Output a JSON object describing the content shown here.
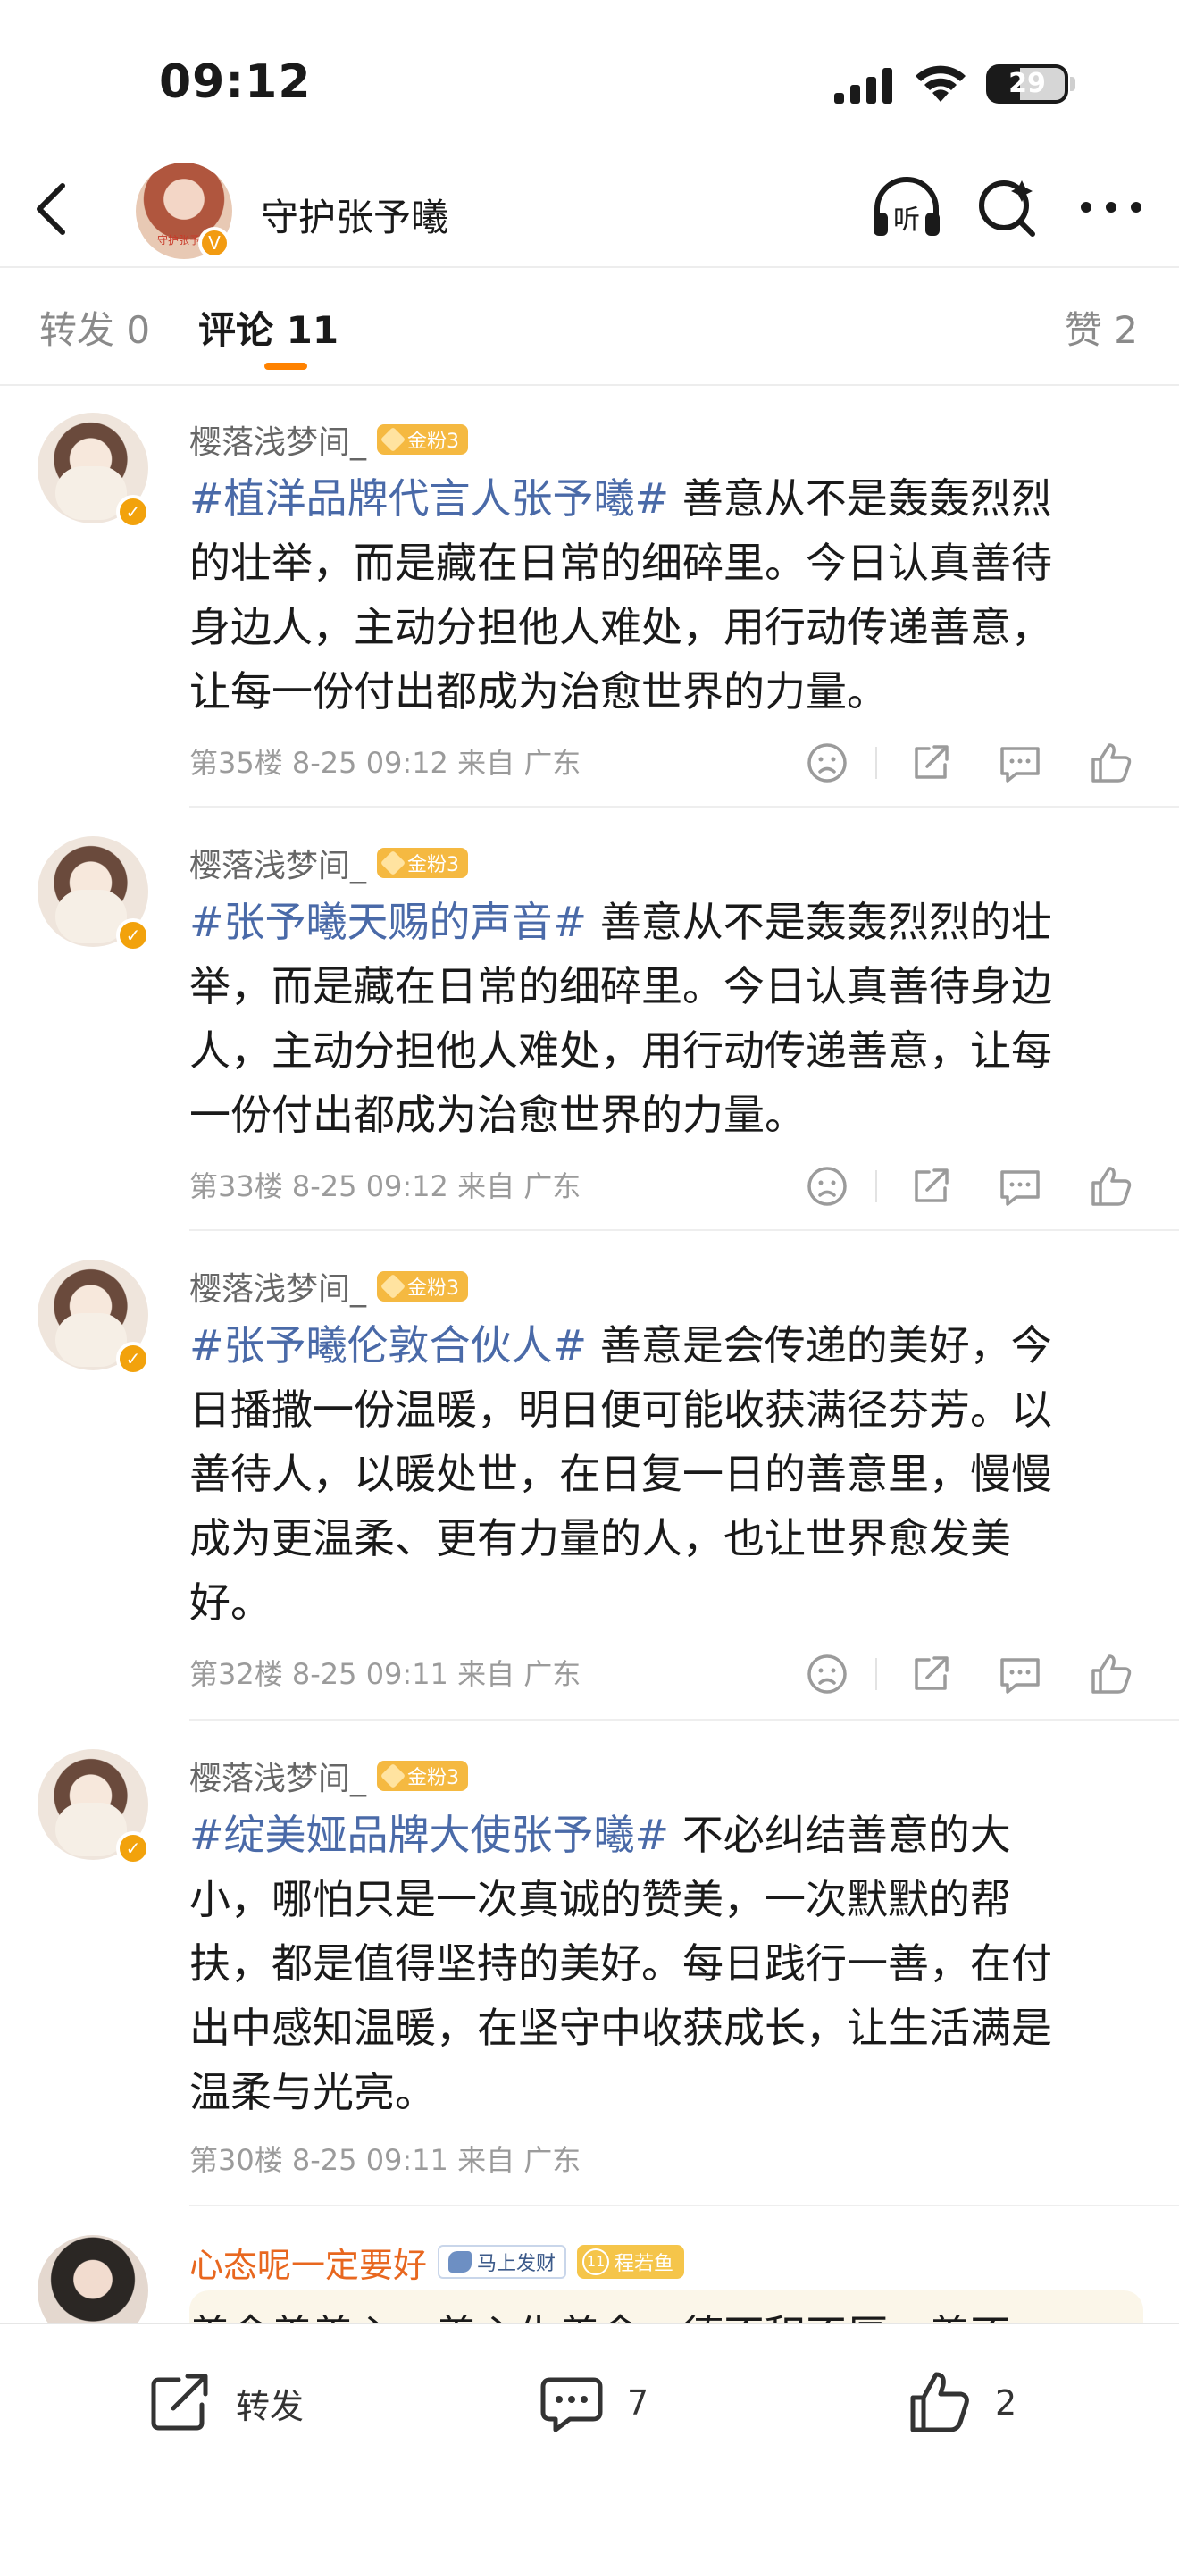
{
  "status_bar": {
    "time": "09:12",
    "battery": "29"
  },
  "nav": {
    "title": "守护张予曦",
    "avatar_caption": "守护张予曦"
  },
  "tabs": {
    "repost": "转发 0",
    "comments": "评论 11",
    "likes": "赞 2"
  },
  "comments": [
    {
      "user": "樱落浅梦间_",
      "badge": "金粉3",
      "topic": "#植洋品牌代言人张予曦#",
      "line1": " 善意从不是轰轰烈烈",
      "line2": "的壮举，而是藏在日常的细碎里。今日认真善待",
      "line3": "身边人，主动分担他人难处，用行动传递善意，",
      "line4": "让每一份付出都成为治愈世界的力量。",
      "meta": "第35楼 8-25 09:12 来自 广东"
    },
    {
      "user": "樱落浅梦间_",
      "badge": "金粉3",
      "topic": "#张予曦天赐的声音#",
      "line1": " 善意从不是轰轰烈烈的壮",
      "line2": "举，而是藏在日常的细碎里。今日认真善待身边",
      "line3": "人，主动分担他人难处，用行动传递善意，让每",
      "line4": "一份付出都成为治愈世界的力量。",
      "meta": "第33楼 8-25 09:12 来自 广东"
    },
    {
      "user": "樱落浅梦间_",
      "badge": "金粉3",
      "topic": "#张予曦伦敦合伙人#",
      "line1": " 善意是会传递的美好，今",
      "line2": "日播撒一份温暖，明日便可能收获满径芬芳。以",
      "line3": "善待人，以暖处世，在日复一日的善意里，慢慢",
      "line4": "成为更温柔、更有力量的人，也让世界愈发美",
      "line5": "好。",
      "meta": "第32楼 8-25 09:11 来自 广东"
    },
    {
      "user": "樱落浅梦间_",
      "badge": "金粉3",
      "topic": "#绽美娅品牌大使张予曦#",
      "line1": " 不必纠结善意的大",
      "line2": "小，哪怕只是一次真诚的赞美，一次默默的帮",
      "line3": "扶，都是值得坚持的美好。每日践行一善，在付",
      "line4": "出中感知温暖，在坚守中收获成长，让生活满是",
      "line5": "温柔与光亮。",
      "meta": "第30楼 8-25 09:11 来自 广东"
    },
    {
      "user": "心态呢一定要好",
      "badge_horse": "马上发财",
      "badge_level_num": "11",
      "badge_level": "程若鱼",
      "line1": "善念善善心，善心生善念，德不积不厚，善不"
    }
  ],
  "bottom_bar": {
    "repost": "转发",
    "comment_count": "7",
    "like_count": "2"
  },
  "colors": {
    "accent": "#ff8200",
    "topic": "#4a6aa8",
    "gold_badge": "#f5b941"
  }
}
